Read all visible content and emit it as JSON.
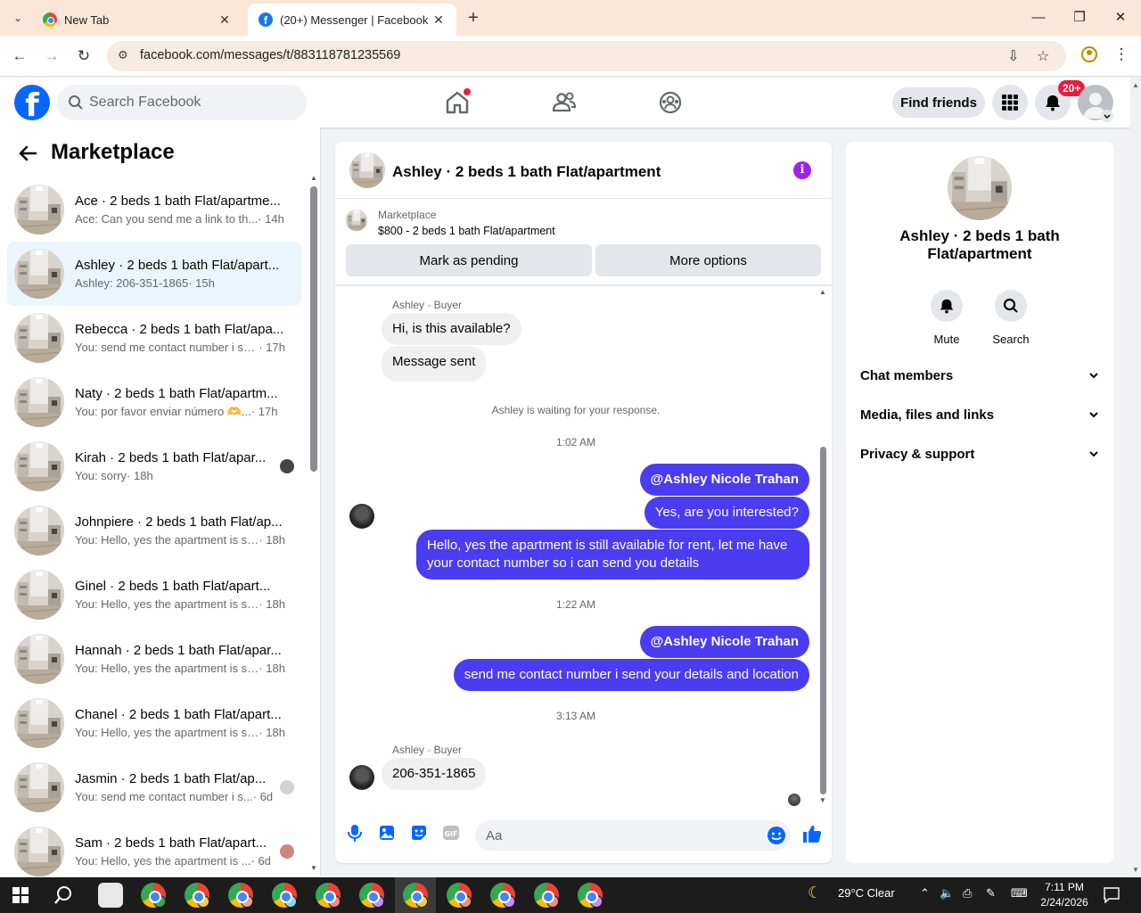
{
  "browser": {
    "tabs": [
      {
        "title": "New Tab",
        "active": false
      },
      {
        "title": "(20+) Messenger | Facebook",
        "active": true
      }
    ],
    "url": "facebook.com/messages/t/883118781235569",
    "new_tab_symbol": "+",
    "close_symbol": "✕"
  },
  "header": {
    "search_placeholder": "Search Facebook",
    "find_friends": "Find friends",
    "notif_badge": "20+",
    "nav_icons": [
      "home-icon",
      "friends-icon",
      "groups-icon"
    ]
  },
  "sidebar": {
    "title": "Marketplace",
    "conversations": [
      {
        "name": "Ace · 2 beds 1 bath Flat/apartme...",
        "preview": "Ace: Can you send me a link to th...",
        "time": " · 14h",
        "selected": false
      },
      {
        "name": "Ashley · 2 beds 1 bath Flat/apart...",
        "preview": "Ashley: 206-351-1865",
        "time": " · 15h",
        "selected": true
      },
      {
        "name": "Rebecca · 2 beds 1 bath Flat/apa...",
        "preview": "You: send me contact number i se...",
        "time": " · 17h",
        "selected": false
      },
      {
        "name": "Naty · 2 beds 1 bath Flat/apartm...",
        "preview": "You: por favor enviar número 🫶...",
        "time": " · 17h",
        "selected": false
      },
      {
        "name": "Kirah · 2 beds 1 bath Flat/apar...",
        "preview": "You: sorry",
        "time": " · 18h",
        "selected": false,
        "mini": true
      },
      {
        "name": "Johnpiere · 2 beds 1 bath Flat/ap...",
        "preview": "You: Hello, yes the apartment is sti...",
        "time": " · 18h",
        "selected": false
      },
      {
        "name": "Ginel · 2 beds 1 bath Flat/apart...",
        "preview": "You: Hello, yes the apartment is sti...",
        "time": " · 18h",
        "selected": false
      },
      {
        "name": "Hannah · 2 beds 1 bath Flat/apar...",
        "preview": "You: Hello, yes the apartment is sti...",
        "time": " · 18h",
        "selected": false
      },
      {
        "name": "Chanel · 2 beds 1 bath Flat/apart...",
        "preview": "You: Hello, yes the apartment is sti...",
        "time": " · 18h",
        "selected": false
      },
      {
        "name": "Jasmin · 2 beds 1 bath Flat/ap...",
        "preview": "You: send me contact number i s...",
        "time": " · 6d",
        "selected": false,
        "mini": true
      },
      {
        "name": "Sam · 2 beds 1 bath Flat/apart...",
        "preview": "You: Hello, yes the apartment is ...",
        "time": " · 6d",
        "selected": false,
        "mini": true
      }
    ]
  },
  "chat": {
    "title": "Ashley · 2 beds 1 bath Flat/apartment",
    "listing_label": "Marketplace",
    "listing_price": "$800 - 2 beds 1 bath Flat/apartment",
    "mark_pending": "Mark as pending",
    "more_options": "More options",
    "sender_label": "Ashley · Buyer",
    "msg_in_1": "Hi, is this available?",
    "msg_in_2": "Message sent",
    "waiting": "Ashley is waiting for your response.",
    "time_1": "1:02 AM",
    "mention": "@Ashley Nicole Trahan",
    "msg_out_1": "Yes, are you interested?",
    "msg_out_2": "Hello, yes the apartment is still available for rent, let me have your contact number so i can send you details",
    "time_2": "1:22 AM",
    "msg_out_3": "send me contact number i send your details and location",
    "time_3": "3:13 AM",
    "msg_in_3": "206-351-1865",
    "composer_placeholder": "Aa"
  },
  "right_panel": {
    "name": "Ashley · 2 beds 1 bath Flat/apartment",
    "mute": "Mute",
    "search": "Search",
    "sections": [
      "Chat members",
      "Media, files and links",
      "Privacy & support"
    ]
  },
  "taskbar": {
    "weather": "29°C  Clear",
    "time": "7:11 PM",
    "date": "2/24/2026"
  },
  "colors": {
    "fb_blue": "#0866ff",
    "outgoing_bubble": "#4a3cf0",
    "badge_red": "#e41e3f",
    "selected_row": "#ebf5ff"
  }
}
